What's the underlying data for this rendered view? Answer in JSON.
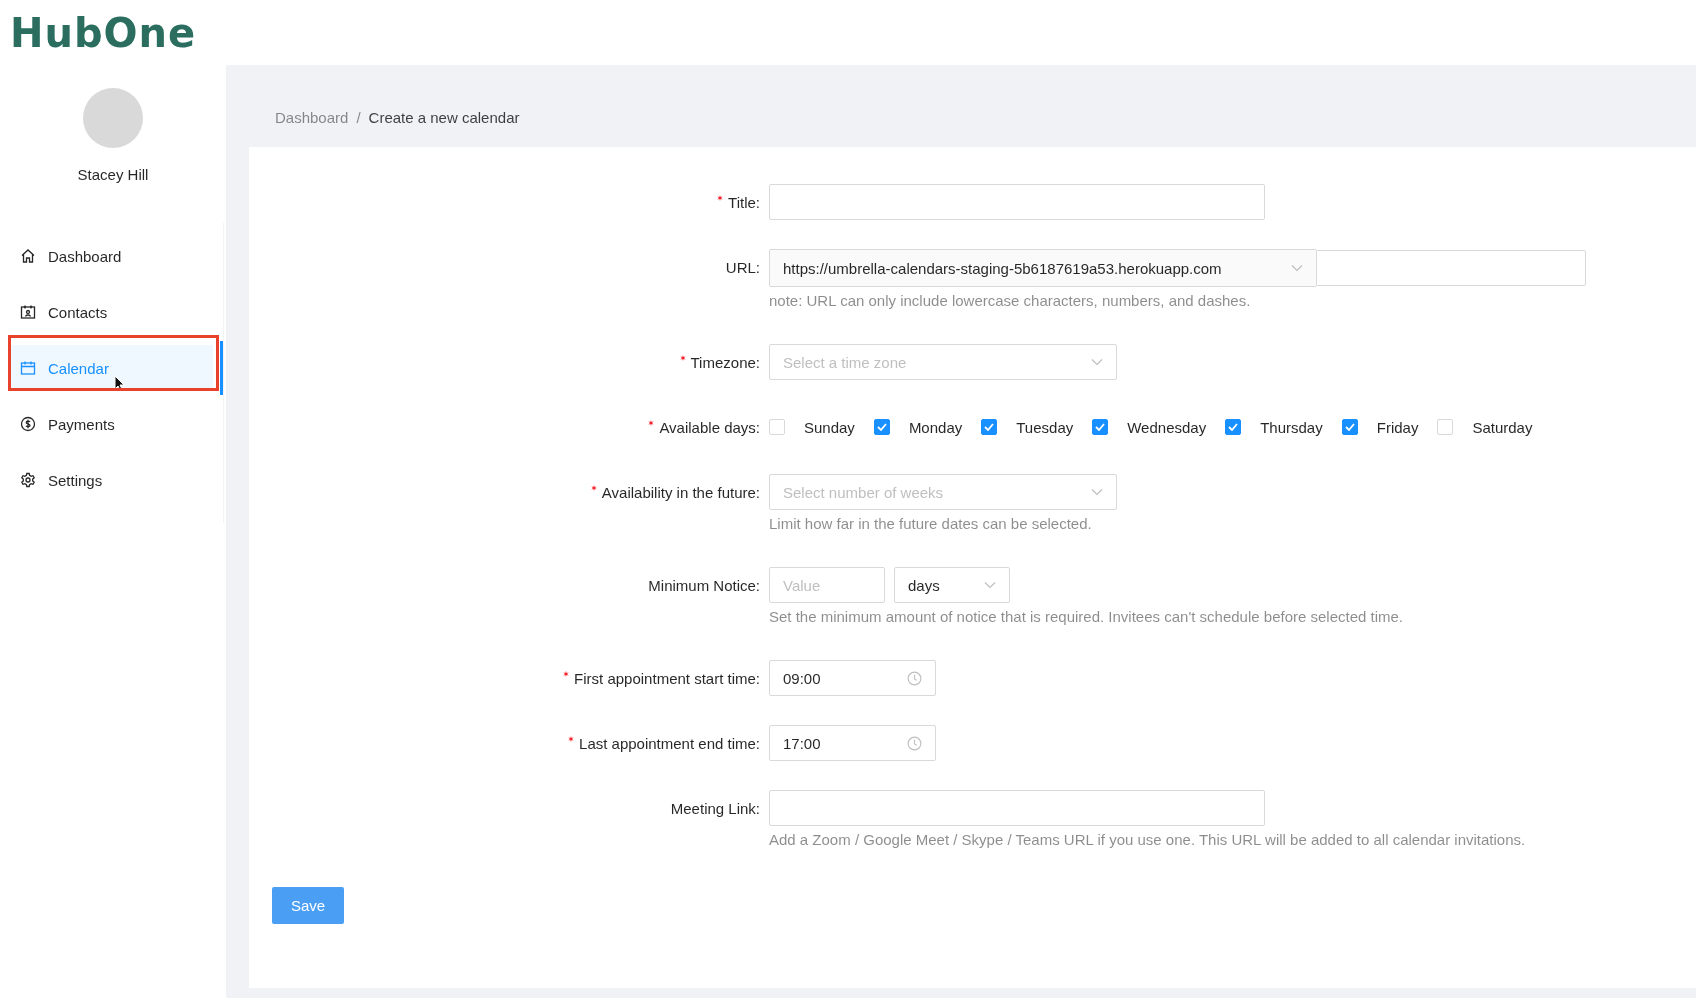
{
  "logo": {
    "text": "HubOne"
  },
  "user": {
    "name": "Stacey Hill"
  },
  "nav": [
    {
      "label": "Dashboard",
      "selected": false,
      "highlighted": false
    },
    {
      "label": "Contacts",
      "selected": false,
      "highlighted": false
    },
    {
      "label": "Calendar",
      "selected": true,
      "highlighted": true
    },
    {
      "label": "Payments",
      "selected": false,
      "highlighted": false
    },
    {
      "label": "Settings",
      "selected": false,
      "highlighted": false
    }
  ],
  "breadcrumb": {
    "separator": "/",
    "items": [
      {
        "label": "Dashboard",
        "current": false
      },
      {
        "label": "Create a new calendar",
        "current": true
      }
    ]
  },
  "form": {
    "fields": [
      {
        "kind": "text",
        "label": "Title:",
        "required": true
      },
      {
        "kind": "url",
        "label": "URL:",
        "required": false,
        "prefix": "https://umbrella-calendars-staging-5b6187619a53.herokuapp.com",
        "help": "note: URL can only include lowercase characters, numbers, and dashes."
      },
      {
        "kind": "select",
        "label": "Timezone:",
        "required": true,
        "placeholder": "Select a time zone"
      },
      {
        "kind": "days",
        "label": "Available days:",
        "required": true,
        "days": [
          {
            "label": "Sunday",
            "checked": false
          },
          {
            "label": "Monday",
            "checked": true
          },
          {
            "label": "Tuesday",
            "checked": true
          },
          {
            "label": "Wednesday",
            "checked": true
          },
          {
            "label": "Thursday",
            "checked": true
          },
          {
            "label": "Friday",
            "checked": true
          },
          {
            "label": "Saturday",
            "checked": false
          }
        ]
      },
      {
        "kind": "select",
        "label": "Availability in the future:",
        "required": true,
        "placeholder": "Select number of weeks",
        "help": "Limit how far in the future dates can be selected."
      },
      {
        "kind": "notice",
        "label": "Minimum Notice:",
        "required": false,
        "placeholder": "Value",
        "unit": "days",
        "help": "Set the minimum amount of notice that is required. Invitees can't schedule before selected time."
      },
      {
        "kind": "time",
        "label": "First appointment start time:",
        "required": true,
        "value": "09:00"
      },
      {
        "kind": "time",
        "label": "Last appointment end time:",
        "required": true,
        "value": "17:00"
      },
      {
        "kind": "text",
        "label": "Meeting Link:",
        "required": false,
        "help": "Add a Zoom / Google Meet / Skype / Teams URL if you use one. This URL will be added to all calendar invitations."
      }
    ]
  },
  "save_button": {
    "label": "Save"
  }
}
